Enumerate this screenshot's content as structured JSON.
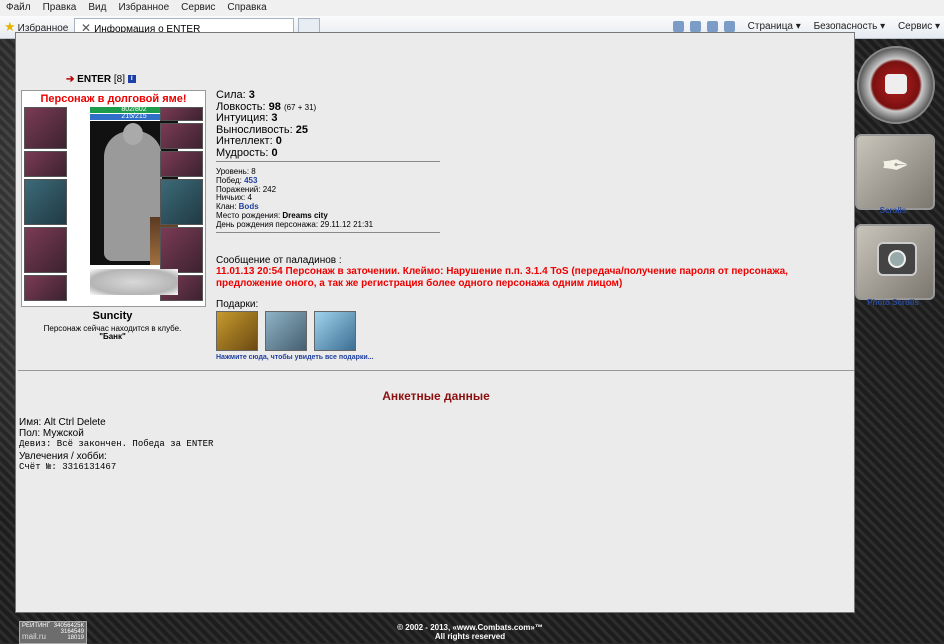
{
  "browser": {
    "menu": [
      "Файл",
      "Правка",
      "Вид",
      "Избранное",
      "Сервис",
      "Справка"
    ],
    "favorites_label": "Избранное",
    "tab_title": "Информация о ENTER",
    "toolbar": [
      "Страница ▾",
      "Безопасность ▾",
      "Сервис ▾"
    ]
  },
  "character": {
    "name": "ENTER",
    "level": "[8]",
    "debt_notice": "Персонаж в долговой яме!",
    "hp": "802/802",
    "mp": "215/215",
    "city": "Suncity",
    "location_text": "Персонаж сейчас находится в клубе.",
    "location_place": "\"Банк\""
  },
  "stats": {
    "strength_label": "Сила:",
    "strength": "3",
    "agility_label": "Ловкость:",
    "agility": "98",
    "agility_sub": "(67 + 31)",
    "intuition_label": "Интуиция:",
    "intuition": "3",
    "endurance_label": "Выносливость:",
    "endurance": "25",
    "intellect_label": "Интеллект:",
    "intellect": "0",
    "wisdom_label": "Мудрость:",
    "wisdom": "0"
  },
  "info": {
    "level_label": "Уровень:",
    "level": "8",
    "wins_label": "Побед:",
    "wins": "453",
    "losses_label": "Поражений:",
    "losses": "242",
    "draws_label": "Ничьих:",
    "draws": "4",
    "clan_label": "Клан:",
    "clan": "Bods",
    "birthplace_label": "Место рождения:",
    "birthplace": "Dreams city",
    "birthday_label": "День рождения персонажа:",
    "birthday": "29.11.12 21:31"
  },
  "message": {
    "title": "Сообщение от паладинов :",
    "text": "11.01.13 20:54 Персонаж в заточении. Клеймо: Нарушение п.п. 3.1.4 ToS (передача/получение пароля от персонажа, предложение оного, а так же регистрация более одного персонажа одним лицом)"
  },
  "gifts": {
    "label": "Подарки:",
    "link": "Нажмите сюда, чтобы увидеть все подарки..."
  },
  "side": {
    "scrolls": "Scrolls",
    "photo_scrolls": "Photo Scrolls"
  },
  "profile": {
    "heading": "Анкетные данные",
    "name_line": "Имя: Alt Ctrl Delete",
    "gender_line": "Пол: Мужской",
    "motto_line": "Девиз: Всё закончен. Победа за ENTER",
    "hobby_line": "Увлечения / хобби:",
    "account_line": "Счёт №: 3316131467"
  },
  "footer": {
    "counter_label": "РЕЙТИНГ",
    "counter_top": "34056425К",
    "counter_mid": "3164549",
    "counter_low": "18019",
    "counter_brand": "mail.ru",
    "copyright": "© 2002 - 2013, «www.Combats.com»™",
    "rights": "All rights reserved"
  },
  "colors": {
    "accent_red": "#e00000",
    "link_blue": "#2040a0",
    "heading": "#8a1010"
  }
}
